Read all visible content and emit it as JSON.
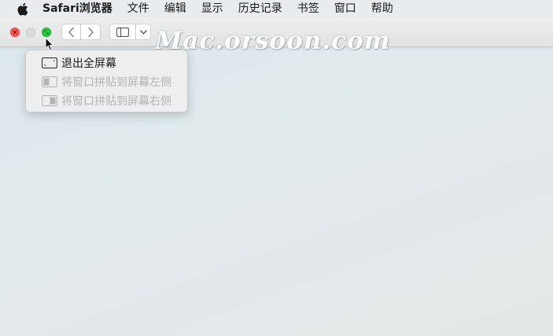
{
  "menubar": {
    "apple_icon": "apple-logo-icon",
    "items": [
      {
        "label": "Safari浏览器"
      },
      {
        "label": "文件"
      },
      {
        "label": "编辑"
      },
      {
        "label": "显示"
      },
      {
        "label": "历史记录"
      },
      {
        "label": "书签"
      },
      {
        "label": "窗口"
      },
      {
        "label": "帮助"
      }
    ]
  },
  "toolbar": {
    "watermark": "Mac.orsoon.com",
    "icons": {
      "back": "chevron-left-icon",
      "forward": "chevron-right-icon",
      "sidebar": "sidebar-icon",
      "sidebar_menu": "chevron-down-icon"
    }
  },
  "window_controls": {
    "close_color": "#fe5f57",
    "minimize_color": "#dcdcdc",
    "zoom_color": "#28c940"
  },
  "fullscreen_menu": {
    "items": [
      {
        "label": "退出全屏幕",
        "enabled": true,
        "icon": "exit-fullscreen-icon"
      },
      {
        "label": "将窗口拼贴到屏幕左侧",
        "enabled": false,
        "icon": "tile-left-icon"
      },
      {
        "label": "将窗口拼贴到屏幕右侧",
        "enabled": false,
        "icon": "tile-right-icon"
      }
    ]
  }
}
